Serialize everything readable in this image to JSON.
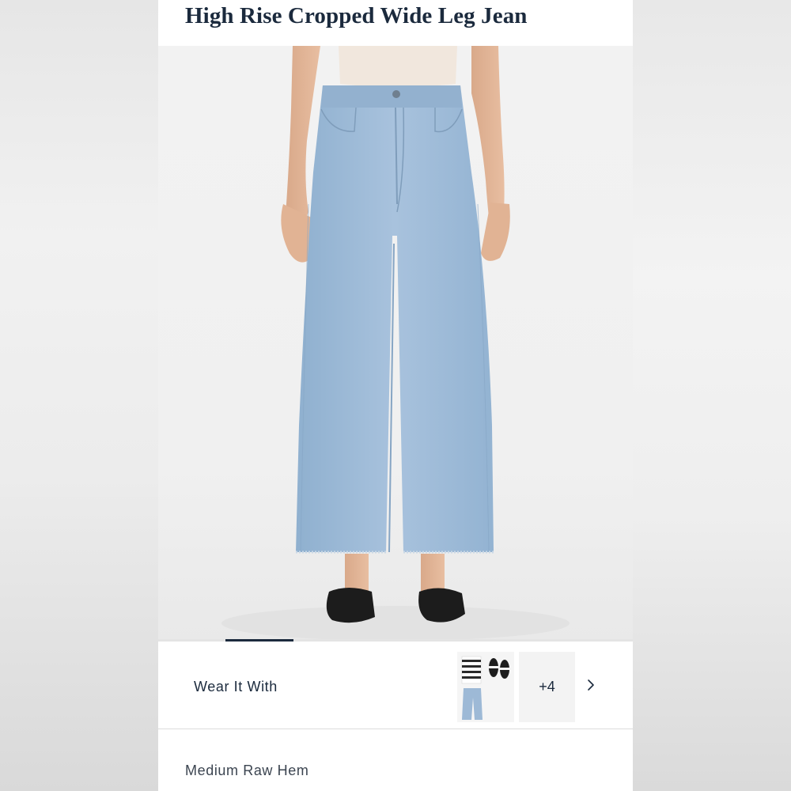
{
  "product": {
    "title": "High Rise Cropped Wide Leg Jean"
  },
  "gallery": {
    "image_alt": "Model wearing light wash high rise cropped wide leg jeans with black flats",
    "active_index_fraction": 0.14
  },
  "wear_it_with": {
    "label": "Wear It With",
    "more_count": "+4"
  },
  "details": {
    "wash_label": "Medium Raw Hem"
  },
  "colors": {
    "navy": "#1b2a3d",
    "denim": "#9db9d6"
  },
  "icons": {
    "chevron": "chevron-right-icon"
  }
}
